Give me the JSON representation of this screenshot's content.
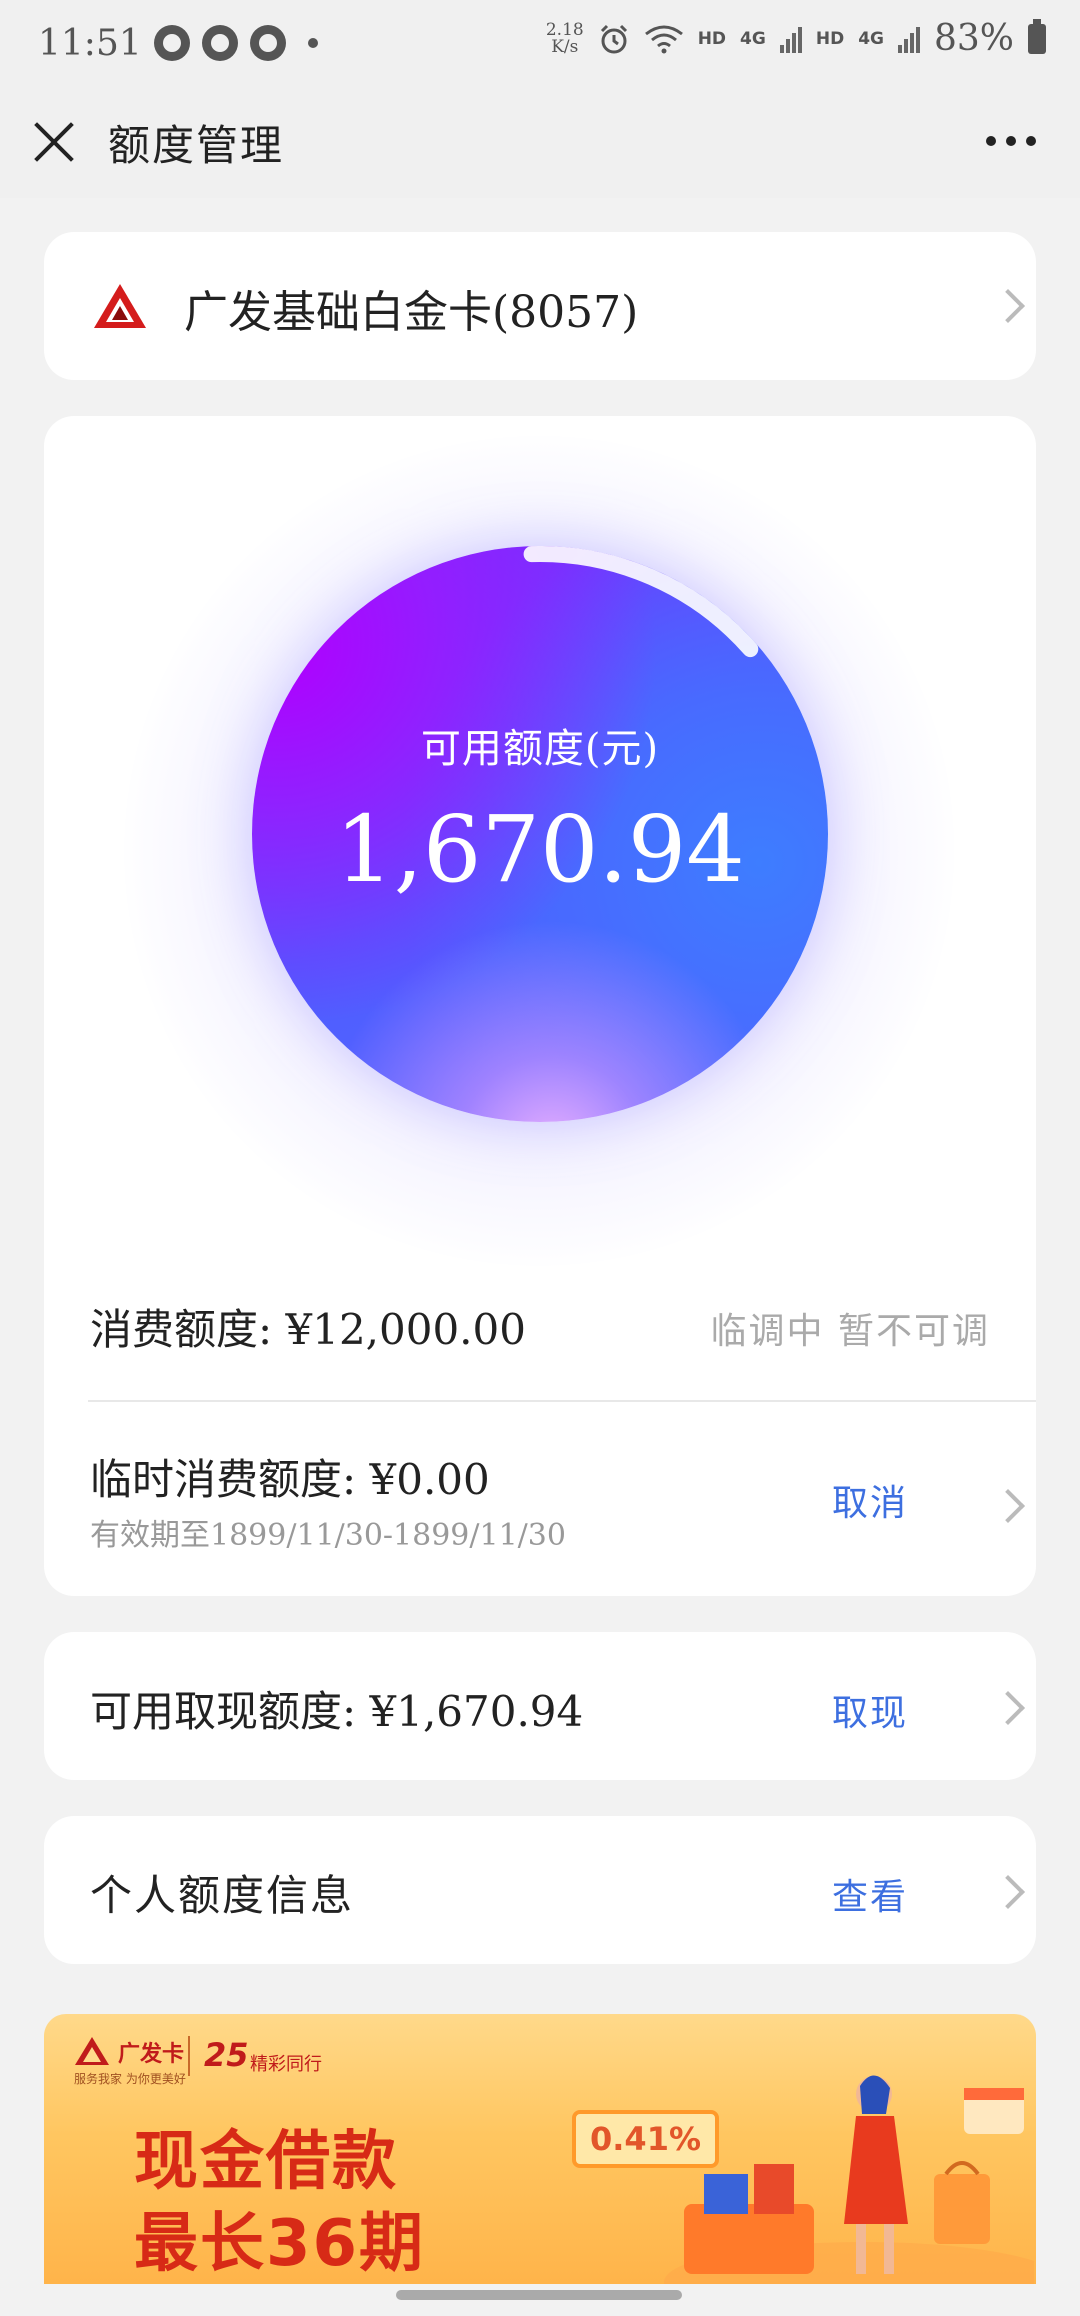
{
  "status_bar": {
    "time": "11:51",
    "speed_top": "2.18",
    "speed_bottom": "K/s",
    "hd1": "HD",
    "net1": "4G",
    "hd2": "HD",
    "net2": "4G",
    "battery": "83%"
  },
  "nav": {
    "title": "额度管理"
  },
  "card": {
    "name": "广发基础白金卡(8057)"
  },
  "available": {
    "label": "可用额度(元)",
    "value": "1,670.94",
    "arc_fraction": 0.14
  },
  "consumption": {
    "label": "消费额度: ¥12,000.00",
    "status": "临调中  暂不可调"
  },
  "temporary": {
    "label": "临时消费额度: ¥0.00",
    "validity": "有效期至1899/11/30-1899/11/30",
    "action": "取消"
  },
  "cash": {
    "label": "可用取现额度: ¥1,670.94",
    "action": "取现"
  },
  "personal": {
    "label": "个人额度信息",
    "action": "查看"
  },
  "banner": {
    "brand": "广发卡",
    "slogan": "服务我家 为你更美好",
    "anniversary": "25",
    "tagline": "精彩同行",
    "headline1": "现金借款",
    "headline2": "最长36期",
    "rate": "0.41%"
  },
  "colors": {
    "accent_link": "#3d6fe0",
    "brand_red": "#d72a16",
    "circle_purple": "#b000ff",
    "circle_blue": "#3e7dff"
  }
}
